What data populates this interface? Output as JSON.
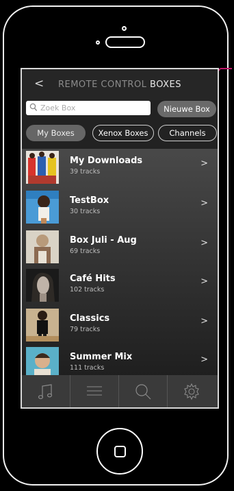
{
  "header": {
    "back_label": "<",
    "title_part1": "REMOTE CONTROL",
    "title_part2": " BOXES"
  },
  "search": {
    "placeholder": "Zoek Box",
    "value": ""
  },
  "new_box_label": "Nieuwe Box",
  "tabs": [
    {
      "label": "My Boxes",
      "active": true
    },
    {
      "label": "Xenox Boxes",
      "active": false
    },
    {
      "label": "Channels",
      "active": false
    }
  ],
  "boxes": [
    {
      "title": "My Downloads",
      "tracks": "39 tracks",
      "chevron": ">"
    },
    {
      "title": "TestBox",
      "tracks": "30 tracks",
      "chevron": ">"
    },
    {
      "title": "Box Juli - Aug",
      "tracks": "69 tracks",
      "chevron": ">"
    },
    {
      "title": "Café Hits",
      "tracks": "102 tracks",
      "chevron": ">"
    },
    {
      "title": "Classics",
      "tracks": "79 tracks",
      "chevron": ">"
    },
    {
      "title": "Summer Mix",
      "tracks": "111 tracks",
      "chevron": ">"
    }
  ],
  "tabbar_icons": [
    "music-note-icon",
    "list-icon",
    "search-icon",
    "gear-icon"
  ],
  "colors": {
    "accent": "#c0186a",
    "background": "#000000",
    "list_bg": "#3a3a3a"
  }
}
